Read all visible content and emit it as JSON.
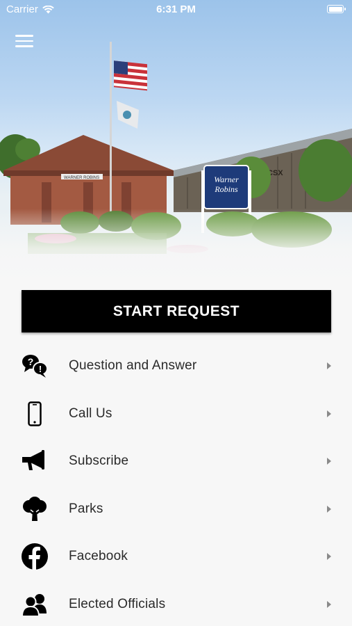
{
  "status_bar": {
    "carrier": "Carrier",
    "time": "6:31 PM"
  },
  "hero": {
    "sign_line1": "Warner",
    "sign_line2": "Robins",
    "building_sign": "WARNER ROBINS",
    "train_label": "CSX"
  },
  "start_request": {
    "label": "START REQUEST"
  },
  "menu": {
    "items": [
      {
        "label": "Question and Answer",
        "icon": "question-answer-icon"
      },
      {
        "label": "Call Us",
        "icon": "phone-icon"
      },
      {
        "label": "Subscribe",
        "icon": "megaphone-icon"
      },
      {
        "label": "Parks",
        "icon": "tree-icon"
      },
      {
        "label": "Facebook",
        "icon": "facebook-icon"
      },
      {
        "label": "Elected Officials",
        "icon": "people-icon"
      }
    ]
  },
  "colors": {
    "button_bg": "#000000",
    "text": "#2a2a2a",
    "background": "#f7f7f7",
    "chevron": "#8a8a8a"
  }
}
